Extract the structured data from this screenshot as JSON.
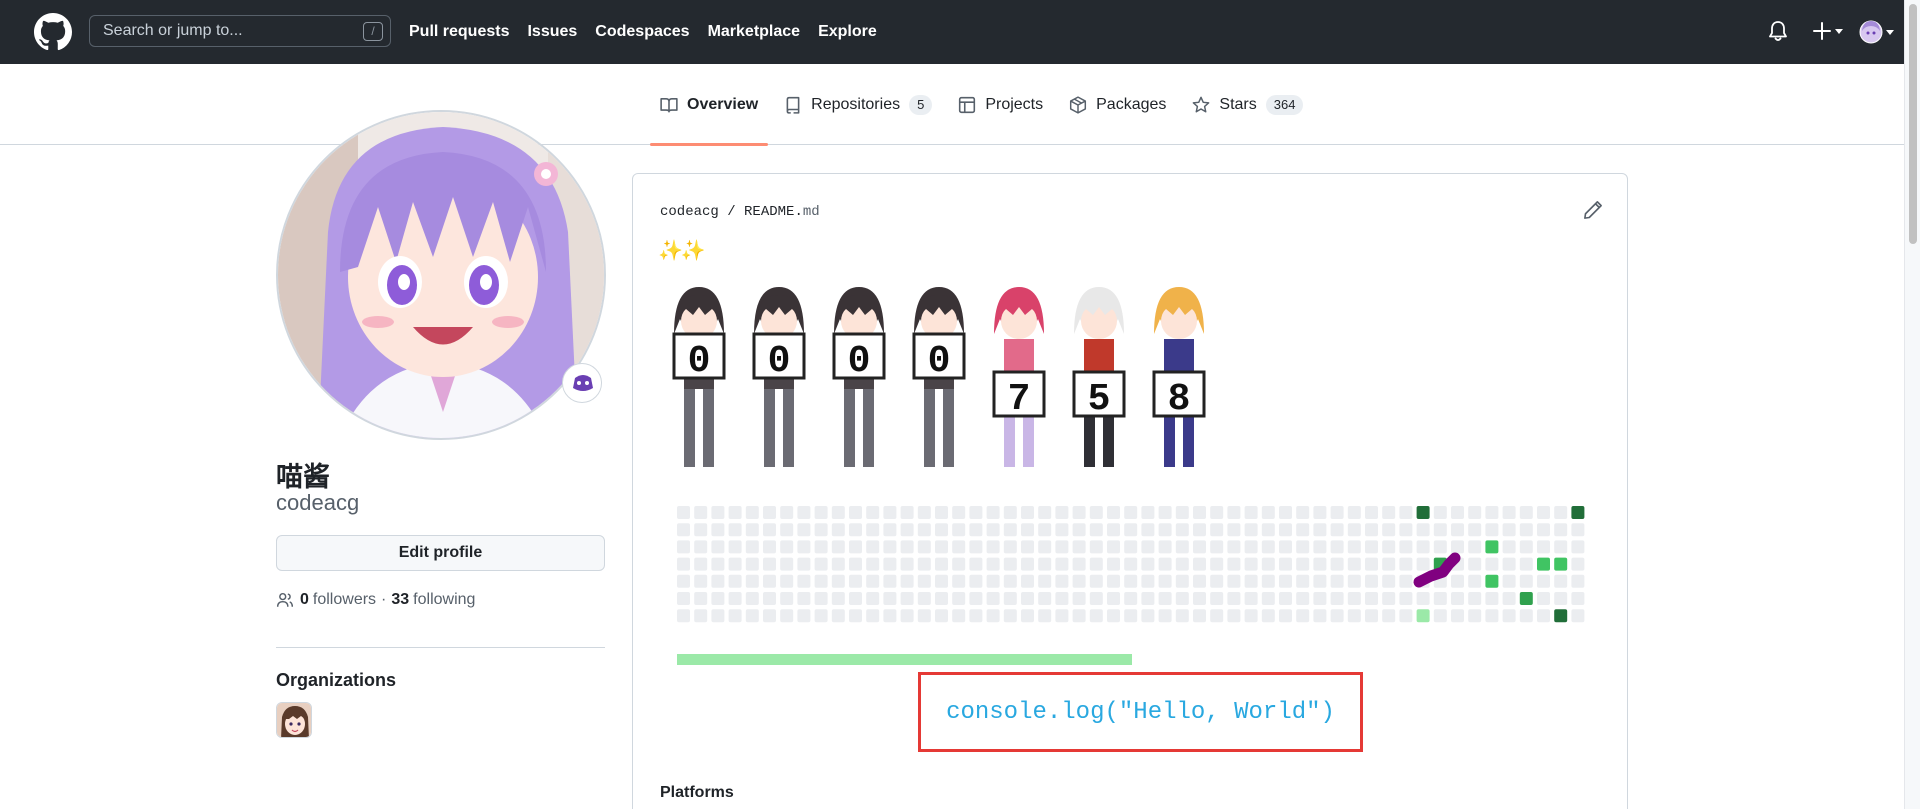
{
  "header": {
    "logo_icon": "github-mark-icon",
    "search_placeholder": "Search or jump to...",
    "search_shortcut": "/",
    "nav": [
      "Pull requests",
      "Issues",
      "Codespaces",
      "Marketplace",
      "Explore"
    ],
    "icons": [
      "bell-icon",
      "plus-icon",
      "caret-down-icon",
      "user-avatar"
    ]
  },
  "tabs": [
    {
      "label": "Overview",
      "icon": "book-icon",
      "active": true,
      "count": null
    },
    {
      "label": "Repositories",
      "icon": "repo-icon",
      "active": false,
      "count": "5"
    },
    {
      "label": "Projects",
      "icon": "table-icon",
      "active": false,
      "count": null
    },
    {
      "label": "Packages",
      "icon": "package-icon",
      "active": false,
      "count": null
    },
    {
      "label": "Stars",
      "icon": "star-icon",
      "active": false,
      "count": "364"
    }
  ],
  "profile": {
    "name": "喵酱",
    "login": "codeacg",
    "edit_button": "Edit profile",
    "followers_count": "0",
    "followers_label": "followers",
    "separator": "·",
    "following_count": "33",
    "following_label": "following",
    "organizations_title": "Organizations",
    "status_icon": "status-emoji-icon"
  },
  "readme": {
    "owner": "codeacg",
    "path_sep": "/",
    "file_base": "README.",
    "file_ext": "md",
    "sparkles": "✨✨",
    "visitor_counter_digits": [
      "0",
      "0",
      "0",
      "0",
      "7",
      "5",
      "8"
    ],
    "code_text": "console.log(\"Hello, World\")",
    "section_heading": "Platforms"
  },
  "colors": {
    "header_bg": "#24292f",
    "active_tab_underline": "#fd8c73",
    "code_border": "#e53935",
    "code_text": "#29a8e0",
    "progress_fill": "#9be9a8",
    "contrib_empty": "#ebedf0",
    "contrib_l1": "#9be9a8",
    "contrib_l2": "#40c463",
    "contrib_l3": "#30a14e",
    "contrib_l4": "#216e39",
    "snake": "#800080"
  }
}
